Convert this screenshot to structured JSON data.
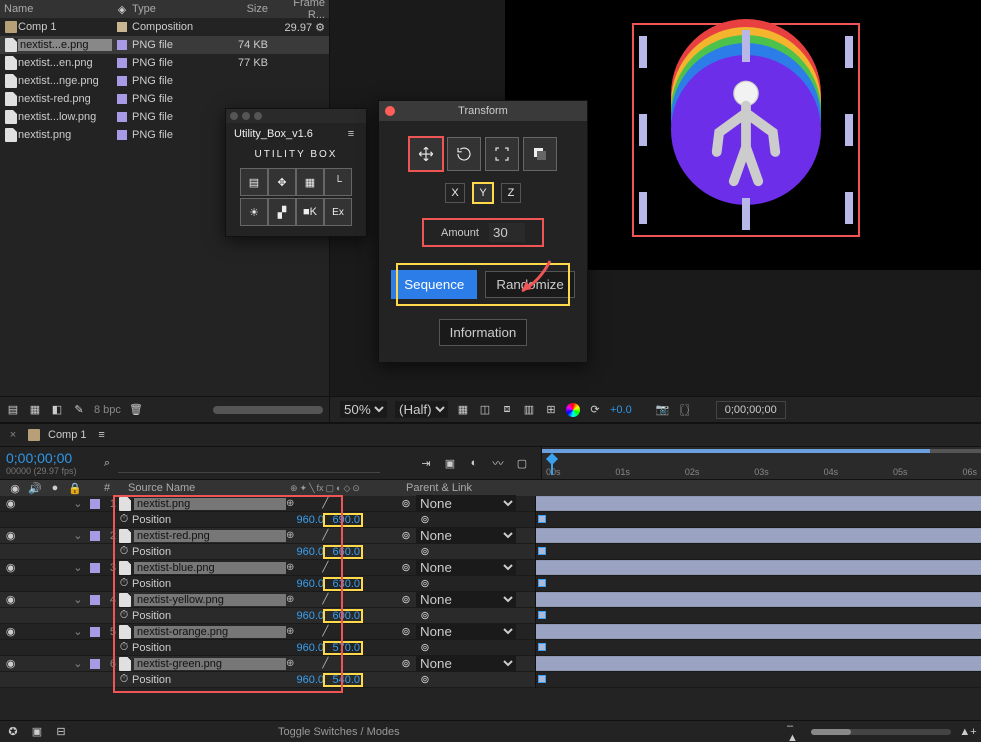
{
  "project": {
    "columns": [
      "Name",
      "Type",
      "Size",
      "Frame R..."
    ],
    "tag_icon": "tag-icon",
    "items": [
      {
        "icon": "comp",
        "name": "Comp 1",
        "tag": "sand",
        "type": "Composition",
        "size": "",
        "fps": "29.97",
        "hasFlow": true
      },
      {
        "icon": "file",
        "name": "nextist...e.png",
        "tag": "lav",
        "type": "PNG file",
        "size": "74 KB",
        "fps": "",
        "selected": true
      },
      {
        "icon": "file",
        "name": "nextist...en.png",
        "tag": "lav",
        "type": "PNG file",
        "size": "77 KB",
        "fps": ""
      },
      {
        "icon": "file",
        "name": "nextist...nge.png",
        "tag": "lav",
        "type": "PNG file",
        "size": "",
        "fps": ""
      },
      {
        "icon": "file",
        "name": "nextist-red.png",
        "tag": "lav",
        "type": "PNG file",
        "size": "",
        "fps": ""
      },
      {
        "icon": "file",
        "name": "nextist...low.png",
        "tag": "lav",
        "type": "PNG file",
        "size": "",
        "fps": ""
      },
      {
        "icon": "file",
        "name": "nextist.png",
        "tag": "lav",
        "type": "PNG file",
        "size": "",
        "fps": ""
      }
    ],
    "bpc": "8 bpc"
  },
  "utility": {
    "close_icon": "close-icon",
    "min_icon": "minimize-icon",
    "max_icon": "maximize-icon",
    "title": "Utility_Box_v1.6",
    "menu_icon": "panel-menu-icon",
    "logo": "UTILITY BOX",
    "grid": [
      [
        "align-icon",
        "snap-icon",
        "grid9-icon",
        "corner-icon"
      ],
      [
        "sun-icon",
        "grid4-icon",
        "camera-icon",
        "ex-icon"
      ]
    ],
    "ex_label": "Ex"
  },
  "transform": {
    "close_icon": "close-red-icon",
    "title": "Transform",
    "modes": [
      "move-icon",
      "rotate-icon",
      "corners-icon",
      "layers-icon"
    ],
    "axes": [
      "X",
      "Y",
      "Z"
    ],
    "amount_label": "Amount",
    "amount_value": "30",
    "sequence": "Sequence",
    "randomize": "Randomize",
    "information": "Information",
    "arrow_icon": "arrow-down-left-icon"
  },
  "viewer": {
    "zoom": "50%",
    "res": "(Half)",
    "icons": [
      "grid-snap-icon",
      "mask-icon",
      "crop-icon",
      "pixel-icon",
      "title-safe-icon"
    ],
    "colorwheel_icon": "color-wheel-icon",
    "refresh_icon": "refresh-icon",
    "exposure": "+0.0",
    "camera_icon": "snapshot-icon",
    "brackets_icon": "preview-range-icon",
    "timecode": "0;00;00;00"
  },
  "composition": {
    "handles": true,
    "circles": [
      "#e84040",
      "#f5b42e",
      "#4cc24c",
      "#2d7de8",
      "#6c2ee8"
    ],
    "character": "character-icon"
  },
  "timeline": {
    "tab_close_icon": "close-icon",
    "tab_label": "Comp 1",
    "tab_menu_icon": "tab-menu-icon",
    "timecode": "0;00;00;00",
    "fps_line": "00000 (29.97 fps)",
    "search_placeholder": "",
    "search_icon": "search-icon",
    "toolbar_icons": [
      "shy-icon",
      "frame-blend-icon",
      "mblur-icon",
      "graph-icon",
      "draft3d-icon"
    ],
    "switch_icons": [
      "eye-icon",
      "speaker-icon",
      "solo-icon",
      "lock-icon"
    ],
    "num_col": "#",
    "src_col": "Source Name",
    "switches_icons": [
      "shy-sw",
      "star-sw",
      "fx-sw",
      "adj-sw",
      "3d-sw",
      "mb-sw",
      "coll-sw",
      "blend-sw"
    ],
    "parent_col": "Parent & Link",
    "ruler": [
      "00s",
      "01s",
      "02s",
      "03s",
      "04s",
      "05s",
      "06s"
    ],
    "layers": [
      {
        "n": 1,
        "name": "nextist.png",
        "px": "960.0",
        "py": "690.0",
        "parent": "None"
      },
      {
        "n": 2,
        "name": "nextist-red.png",
        "px": "960.0",
        "py": "660.0",
        "parent": "None"
      },
      {
        "n": 3,
        "name": "nextist-blue.png",
        "px": "960.0",
        "py": "630.0",
        "parent": "None"
      },
      {
        "n": 4,
        "name": "nextist-yellow.png",
        "px": "960.0",
        "py": "600.0",
        "parent": "None"
      },
      {
        "n": 5,
        "name": "nextist-orange.png",
        "px": "960.0",
        "py": "570.0",
        "parent": "None"
      },
      {
        "n": 6,
        "name": "nextist-green.png",
        "px": "960.0",
        "py": "540.0",
        "parent": "None"
      }
    ],
    "position_label": "Position",
    "stopwatch_icon": "stopwatch-icon",
    "pickwhip_icon": "pickwhip-icon",
    "chevron_icon": "chevron-down-icon",
    "toggle": "Toggle Switches / Modes",
    "footer_icons": [
      "effects-icon",
      "frame-icon",
      "zoom-out-icon"
    ],
    "zoom_in_icon": "zoom-in-icon"
  }
}
